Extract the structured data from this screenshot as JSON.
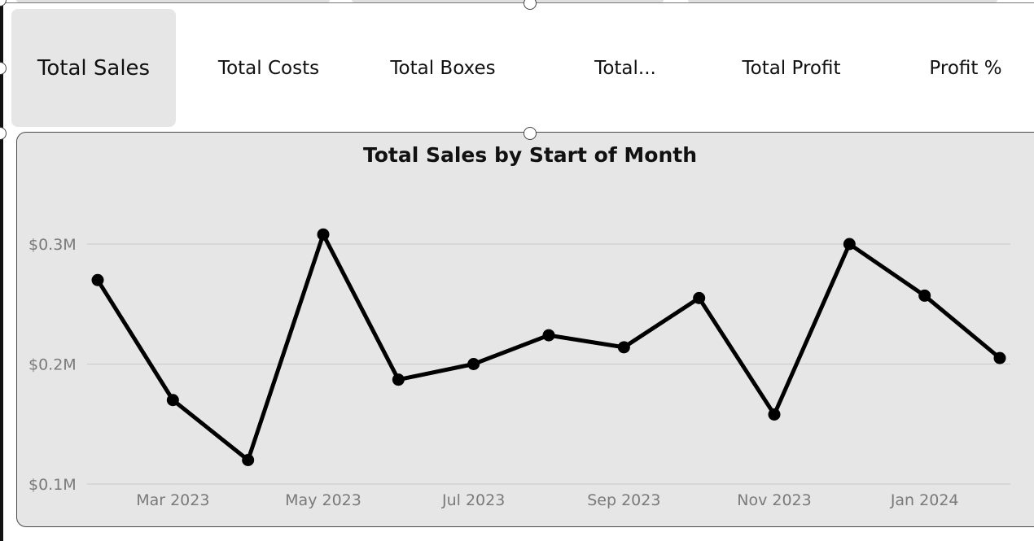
{
  "slicer": {
    "selected_index": 0,
    "items": [
      {
        "label": "Total Sales"
      },
      {
        "label": "Total Costs"
      },
      {
        "label": "Total Boxes"
      },
      {
        "label": "Total..."
      },
      {
        "label": "Total Profit"
      },
      {
        "label": "Profit %"
      }
    ]
  },
  "chart_data": {
    "type": "line",
    "title": "Total Sales by Start of Month",
    "xlabel": "",
    "ylabel": "",
    "x": [
      "Feb 2023",
      "Mar 2023",
      "Apr 2023",
      "May 2023",
      "Jun 2023",
      "Jul 2023",
      "Aug 2023",
      "Sep 2023",
      "Oct 2023",
      "Nov 2023",
      "Dec 2023",
      "Jan 2024",
      "Feb 2024"
    ],
    "x_tick_labels": [
      "Mar 2023",
      "May 2023",
      "Jul 2023",
      "Sep 2023",
      "Nov 2023",
      "Jan 2024"
    ],
    "series": [
      {
        "values": [
          0.27,
          0.17,
          0.12,
          0.308,
          0.187,
          0.2,
          0.224,
          0.214,
          0.255,
          0.158,
          0.3,
          0.257,
          0.205
        ]
      }
    ],
    "y_ticks": [
      {
        "value": 0.1,
        "label": "$0.1M"
      },
      {
        "value": 0.2,
        "label": "$0.2M"
      },
      {
        "value": 0.3,
        "label": "$0.3M"
      }
    ],
    "ylim": [
      0.1,
      0.3
    ],
    "grid": true,
    "line_color": "#000000",
    "legend": "none"
  }
}
